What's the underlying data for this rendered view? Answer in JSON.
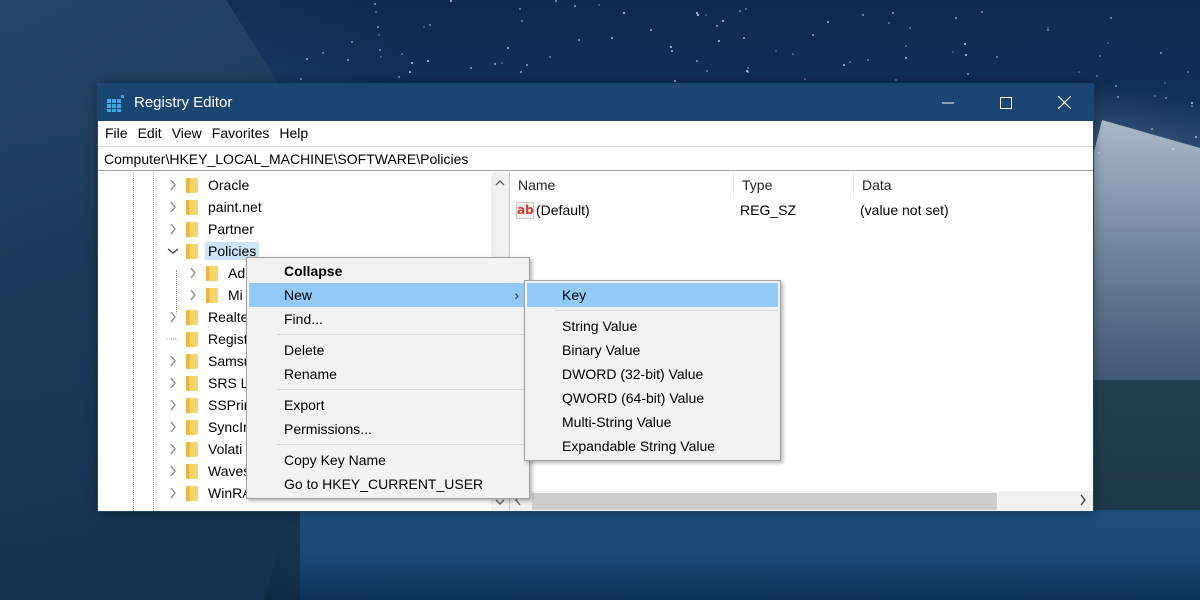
{
  "window": {
    "title": "Registry Editor",
    "controls": {
      "minimize": "minimize",
      "maximize": "maximize",
      "close": "close"
    }
  },
  "menubar": [
    "File",
    "Edit",
    "View",
    "Favorites",
    "Help"
  ],
  "address": "Computer\\HKEY_LOCAL_MACHINE\\SOFTWARE\\Policies",
  "tree": {
    "items": [
      {
        "label": "Oracle",
        "expander": "collapsed",
        "level": 0
      },
      {
        "label": "paint.net",
        "expander": "collapsed",
        "level": 0
      },
      {
        "label": "Partner",
        "expander": "collapsed",
        "level": 0
      },
      {
        "label": "Policies",
        "expander": "expanded",
        "level": 0,
        "selected": true
      },
      {
        "label": "Ad",
        "expander": "collapsed",
        "level": 1
      },
      {
        "label": "Mi",
        "expander": "collapsed",
        "level": 1
      },
      {
        "label": "Realte",
        "expander": "collapsed",
        "level": 0
      },
      {
        "label": "Regist",
        "expander": "none",
        "level": 0
      },
      {
        "label": "Samsu",
        "expander": "collapsed",
        "level": 0
      },
      {
        "label": "SRS La",
        "expander": "collapsed",
        "level": 0
      },
      {
        "label": "SSPrin",
        "expander": "collapsed",
        "level": 0
      },
      {
        "label": "SyncIr",
        "expander": "collapsed",
        "level": 0
      },
      {
        "label": "Volati",
        "expander": "collapsed",
        "level": 0
      },
      {
        "label": "Waves",
        "expander": "collapsed",
        "level": 0
      },
      {
        "label": "WinRA",
        "expander": "collapsed",
        "level": 0
      }
    ]
  },
  "list": {
    "columns": [
      "Name",
      "Type",
      "Data"
    ],
    "rows": [
      {
        "icon": "ab",
        "name": "(Default)",
        "type": "REG_SZ",
        "data": "(value not set)"
      }
    ]
  },
  "context_menu": {
    "groups": [
      [
        {
          "label": "Collapse",
          "bold": true
        },
        {
          "label": "New",
          "highlighted": true,
          "submenu_arrow": "›"
        },
        {
          "label": "Find..."
        }
      ],
      [
        {
          "label": "Delete"
        },
        {
          "label": "Rename"
        }
      ],
      [
        {
          "label": "Export"
        },
        {
          "label": "Permissions..."
        }
      ],
      [
        {
          "label": "Copy Key Name"
        },
        {
          "label": "Go to HKEY_CURRENT_USER"
        }
      ]
    ]
  },
  "submenu": {
    "groups": [
      [
        {
          "label": "Key",
          "highlighted": true
        }
      ],
      [
        {
          "label": "String Value"
        },
        {
          "label": "Binary Value"
        },
        {
          "label": "DWORD (32-bit) Value"
        },
        {
          "label": "QWORD (64-bit) Value"
        },
        {
          "label": "Multi-String Value"
        },
        {
          "label": "Expandable String Value"
        }
      ]
    ]
  },
  "colors": {
    "titlebar": "#1a4671",
    "selection": "#cce4f7",
    "menu_highlight": "#91c9f7",
    "menu_bg": "#f2f2f2"
  }
}
